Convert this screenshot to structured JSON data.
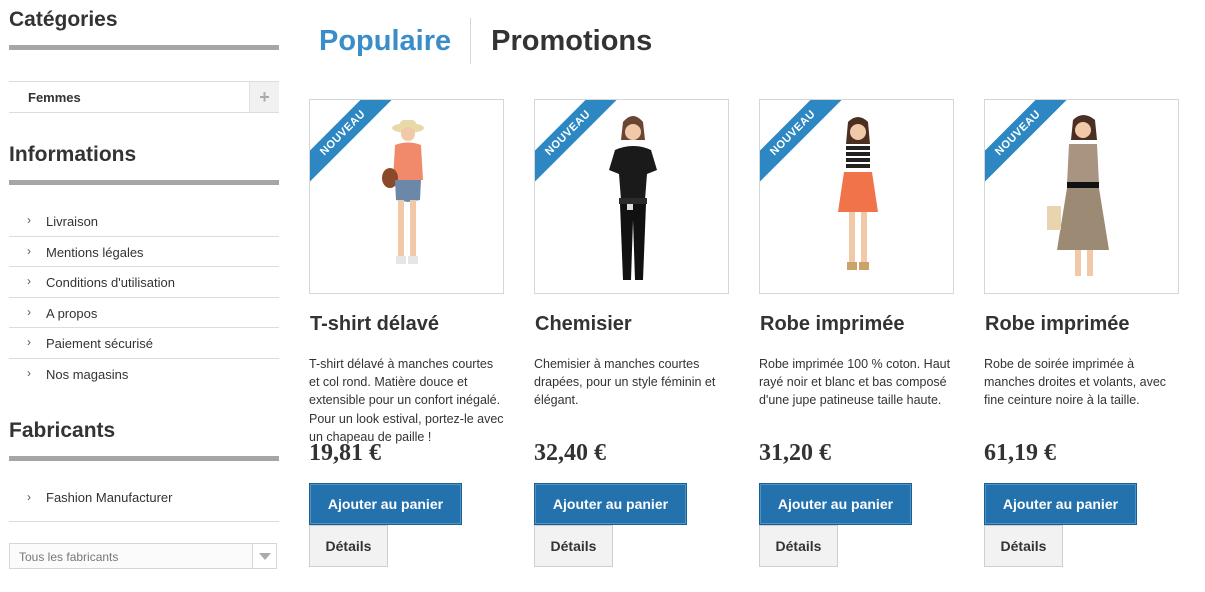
{
  "sidebar": {
    "categories": {
      "title": "Catégories",
      "items": [
        {
          "label": "Femmes",
          "expand_icon": "+"
        }
      ]
    },
    "informations": {
      "title": "Informations",
      "items": [
        {
          "label": "Livraison"
        },
        {
          "label": "Mentions légales"
        },
        {
          "label": "Conditions d'utilisation"
        },
        {
          "label": "A propos"
        },
        {
          "label": "Paiement sécurisé"
        },
        {
          "label": "Nos magasins"
        }
      ]
    },
    "fabricants": {
      "title": "Fabricants",
      "items": [
        {
          "label": "Fashion Manufacturer"
        }
      ],
      "select": {
        "selected": "Tous les fabricants"
      }
    }
  },
  "tabs": [
    {
      "label": "Populaire",
      "active": true
    },
    {
      "label": "Promotions",
      "active": false
    }
  ],
  "products": [
    {
      "badge": "NOUVEAU",
      "name": "T-shirt délavé",
      "description": "T-shirt délavé à manches courtes et col rond. Matière douce et extensible pour un confort inégalé. Pour un look estival, portez-le avec un chapeau de paille !",
      "price": "19,81 €",
      "cart_label": "Ajouter au panier",
      "details_label": "Détails"
    },
    {
      "badge": "NOUVEAU",
      "name": "Chemisier",
      "description": "Chemisier à manches courtes drapées, pour un style féminin et élégant.",
      "price": "32,40 €",
      "cart_label": "Ajouter au panier",
      "details_label": "Détails"
    },
    {
      "badge": "NOUVEAU",
      "name": "Robe imprimée",
      "description": "Robe imprimée 100 % coton. Haut rayé noir et blanc et bas composé d'une jupe patineuse taille haute.",
      "price": "31,20 €",
      "cart_label": "Ajouter au panier",
      "details_label": "Détails"
    },
    {
      "badge": "NOUVEAU",
      "name": "Robe imprimée",
      "description": "Robe de soirée imprimée à manches droites et volants, avec fine ceinture noire à la taille.",
      "price": "61,19 €",
      "cart_label": "Ajouter au panier",
      "details_label": "Détails"
    }
  ],
  "colors": {
    "accent": "#3a8dc9",
    "button_primary": "#2472ad",
    "ribbon": "#2c87c2",
    "block_bar": "#a6a6a6"
  },
  "icons": {
    "chevron": "chevron-right-icon",
    "expand": "plus-icon",
    "dropdown": "chevron-down-icon"
  }
}
